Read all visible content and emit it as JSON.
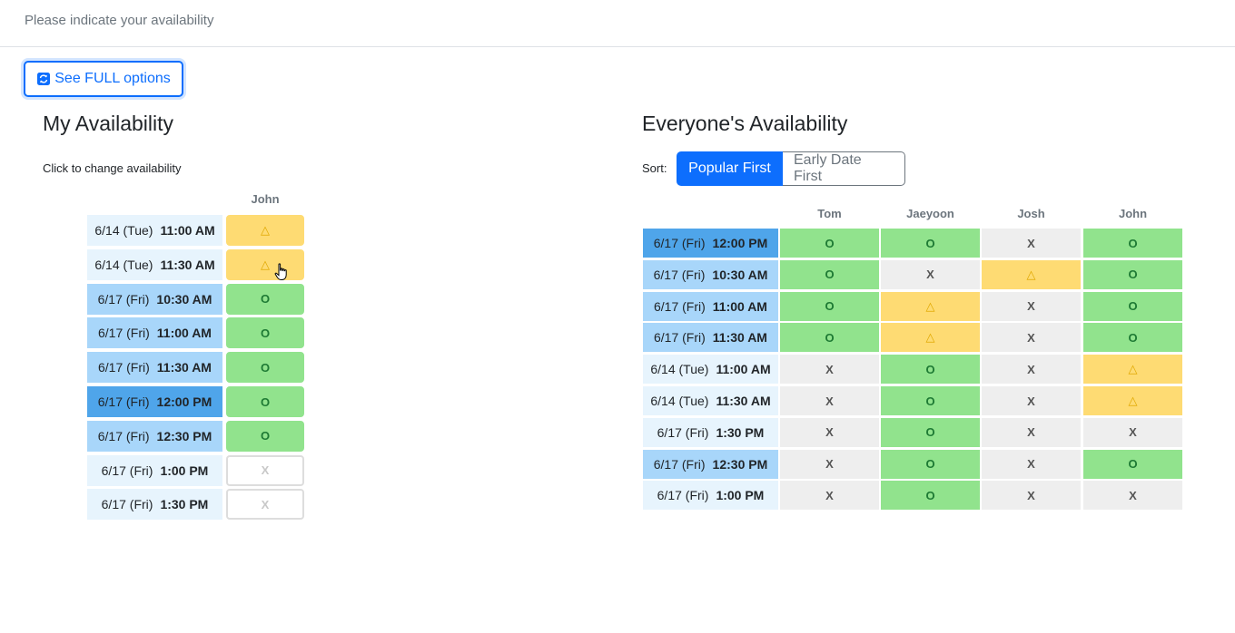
{
  "header": {
    "prompt": "Please indicate your availability"
  },
  "full_options_button": {
    "label": "See FULL options",
    "icon": "refresh-icon"
  },
  "my_availability": {
    "title": "My Availability",
    "hint": "Click to change availability",
    "person": "John",
    "rows": [
      {
        "date": "6/14 (Tue)",
        "time": "11:00 AM",
        "level": 1,
        "status": "t",
        "mark": "△"
      },
      {
        "date": "6/14 (Tue)",
        "time": "11:30 AM",
        "level": 1,
        "status": "t",
        "mark": "△"
      },
      {
        "date": "6/17 (Fri)",
        "time": "10:30 AM",
        "level": 2,
        "status": "o",
        "mark": "O"
      },
      {
        "date": "6/17 (Fri)",
        "time": "11:00 AM",
        "level": 2,
        "status": "o",
        "mark": "O"
      },
      {
        "date": "6/17 (Fri)",
        "time": "11:30 AM",
        "level": 2,
        "status": "o",
        "mark": "O"
      },
      {
        "date": "6/17 (Fri)",
        "time": "12:00 PM",
        "level": 3,
        "status": "o",
        "mark": "O"
      },
      {
        "date": "6/17 (Fri)",
        "time": "12:30 PM",
        "level": 2,
        "status": "o",
        "mark": "O"
      },
      {
        "date": "6/17 (Fri)",
        "time": "1:00 PM",
        "level": 1,
        "status": "x",
        "mark": "X"
      },
      {
        "date": "6/17 (Fri)",
        "time": "1:30 PM",
        "level": 1,
        "status": "x",
        "mark": "X"
      }
    ]
  },
  "everyone": {
    "title": "Everyone's Availability",
    "sort_label": "Sort:",
    "sort_options": [
      "Popular First",
      "Early Date First"
    ],
    "active_sort": "Popular First",
    "people": [
      "Tom",
      "Jaeyoon",
      "Josh",
      "John"
    ],
    "rows": [
      {
        "date": "6/17 (Fri)",
        "time": "12:00 PM",
        "level": 3,
        "cells": [
          "O",
          "O",
          "X",
          "O"
        ]
      },
      {
        "date": "6/17 (Fri)",
        "time": "10:30 AM",
        "level": 2,
        "cells": [
          "O",
          "X",
          "△",
          "O"
        ]
      },
      {
        "date": "6/17 (Fri)",
        "time": "11:00 AM",
        "level": 2,
        "cells": [
          "O",
          "△",
          "X",
          "O"
        ]
      },
      {
        "date": "6/17 (Fri)",
        "time": "11:30 AM",
        "level": 2,
        "cells": [
          "O",
          "△",
          "X",
          "O"
        ]
      },
      {
        "date": "6/14 (Tue)",
        "time": "11:00 AM",
        "level": 1,
        "cells": [
          "X",
          "O",
          "X",
          "△"
        ]
      },
      {
        "date": "6/14 (Tue)",
        "time": "11:30 AM",
        "level": 1,
        "cells": [
          "X",
          "O",
          "X",
          "△"
        ]
      },
      {
        "date": "6/17 (Fri)",
        "time": "1:30 PM",
        "level": 1,
        "cells": [
          "X",
          "O",
          "X",
          "X"
        ]
      },
      {
        "date": "6/17 (Fri)",
        "time": "12:30 PM",
        "level": 2,
        "cells": [
          "X",
          "O",
          "X",
          "O"
        ]
      },
      {
        "date": "6/17 (Fri)",
        "time": "1:00 PM",
        "level": 1,
        "cells": [
          "X",
          "O",
          "X",
          "X"
        ]
      }
    ]
  },
  "colors": {
    "available": "#91e38d",
    "maybe": "#fedb73",
    "unavailable": "#eeeeee",
    "primary": "#0d6efd",
    "slot_level_1": "#e7f4fd",
    "slot_level_2": "#a8d6fa",
    "slot_level_3": "#4fa5ea"
  }
}
